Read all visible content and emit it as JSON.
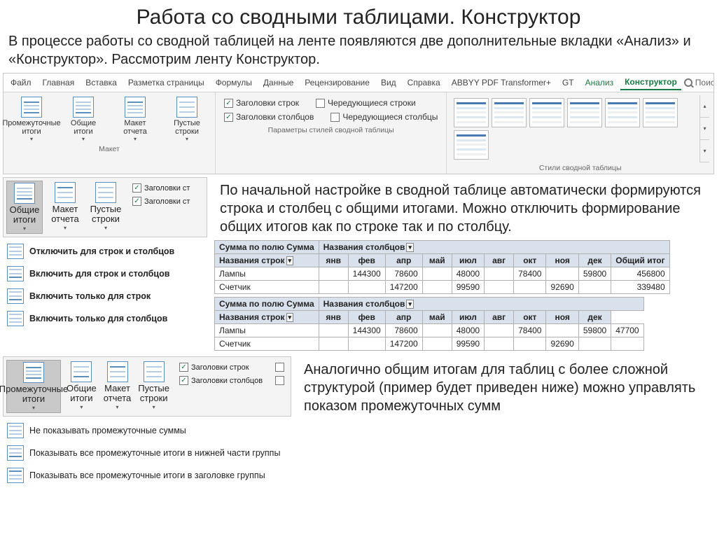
{
  "title": "Работа со сводными таблицами. Конструктор",
  "intro": "В процессе работы со сводной таблицей на ленте появляются две дополнительные вкладки «Анализ» и «Конструктор». Рассмотрим ленту Конструктор.",
  "ribbon": {
    "tabs": [
      "Файл",
      "Главная",
      "Вставка",
      "Разметка страницы",
      "Формулы",
      "Данные",
      "Рецензирование",
      "Вид",
      "Справка",
      "ABBYY PDF Transformer+",
      "GT",
      "Анализ",
      "Конструктор"
    ],
    "search": "Поиск",
    "groups": {
      "layout": {
        "subtotals": "Промежуточные\nитоги",
        "grand": "Общие\nитоги",
        "layoutBtn": "Макет\nотчета",
        "blank": "Пустые\nстроки",
        "caption": "Макет"
      },
      "styleOpts": {
        "rowHeaders": "Заголовки строк",
        "colHeaders": "Заголовки столбцов",
        "bandedRows": "Чередующиеся строки",
        "bandedCols": "Чередующиеся столбцы",
        "caption": "Параметры стилей сводной таблицы"
      },
      "galleryCaption": "Стили сводной таблицы"
    }
  },
  "grandMenu": {
    "btn": "Общие\nитоги",
    "chk1": "Заголовки ст",
    "chk2": "Заголовки ст",
    "items": [
      "Отключить для строк и столбцов",
      "Включить для строк и столбцов",
      "Включить только для строк",
      "Включить только для столбцов"
    ]
  },
  "explain1": "По начальной настройке в сводной таблице автоматически формируются строка и столбец с общими итогами. Можно отключить формирование общих итогов как по строке так и по столбцу.",
  "pivot": {
    "sumLabel": "Сумма по полю Сумма",
    "colLabel": "Названия столбцов",
    "rowLabel": "Названия строк",
    "months": [
      "янв",
      "фев",
      "апр",
      "май",
      "июл",
      "авг",
      "окт",
      "ноя",
      "дек"
    ],
    "grandCol": "Общий итог",
    "rows": [
      {
        "name": "Лампы",
        "vals": [
          "",
          "144300",
          "78600",
          "",
          "48000",
          "",
          "78400",
          "",
          "59800",
          "47700"
        ],
        "total": "456800"
      },
      {
        "name": "Счетчик",
        "vals": [
          "",
          "",
          "147200",
          "",
          "99590",
          "",
          "",
          "92690",
          "",
          ""
        ],
        "total": "339480"
      }
    ]
  },
  "subtotalMenu": {
    "btn": "Промежуточные\nитоги",
    "items": [
      "Не показывать промежуточные суммы",
      "Показывать все промежуточные итоги в нижней части группы",
      "Показывать все промежуточные итоги в заголовке группы"
    ]
  },
  "explain2": "Аналогично общим итогам для таблиц с более сложной структурой (пример будет приведен ниже) можно управлять показом промежуточных сумм"
}
